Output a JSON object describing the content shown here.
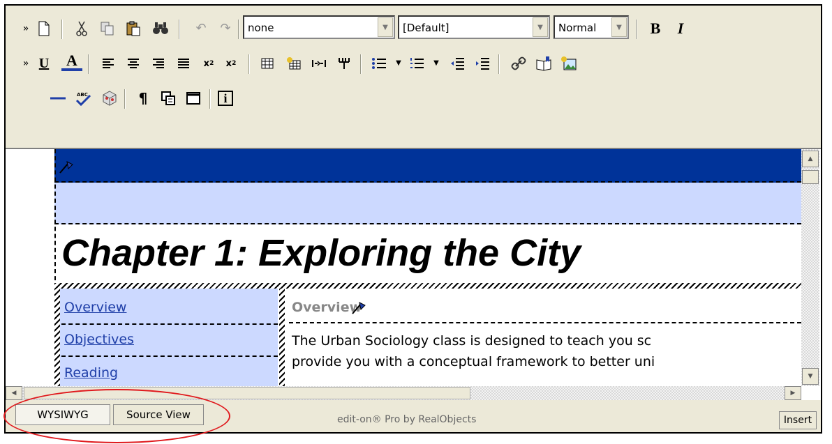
{
  "toolbar": {
    "style_combo": "none",
    "font_combo": "[Default]",
    "size_combo": "Normal",
    "bold_label": "B",
    "italic_label": "I",
    "underline_label": "U",
    "font_color_label": "A",
    "info_label": "i",
    "icons": [
      "new-document-icon",
      "cut-icon",
      "copy-icon",
      "paste-icon",
      "find-icon",
      "undo-icon",
      "redo-icon",
      "bold-icon",
      "italic-icon",
      "underline-icon",
      "font-color-icon",
      "align-left-icon",
      "align-center-icon",
      "align-right-icon",
      "justify-icon",
      "subscript-icon",
      "superscript-icon",
      "table-icon",
      "insert-cell-icon",
      "split-cell-icon",
      "merge-cell-icon",
      "bullet-list-icon",
      "numbered-list-icon",
      "outdent-icon",
      "indent-icon",
      "hyperlink-icon",
      "bookmark-icon",
      "insert-image-icon",
      "horizontal-rule-icon",
      "spell-check-icon",
      "object-icon",
      "paragraph-marks-icon",
      "special-char-icon",
      "fullscreen-icon",
      "about-icon"
    ]
  },
  "document": {
    "title": "Chapter 1: Exploring the City",
    "nav": [
      "Overview",
      "Objectives",
      "Reading"
    ],
    "overview_heading": "Overview",
    "body_lines": [
      "The Urban Sociology class is designed to teach you sc",
      "provide you with a conceptual framework to better uni"
    ]
  },
  "status": {
    "tab_wysiwyg": "WYSIWYG",
    "tab_source": "Source View",
    "credit": "edit-on® Pro by RealObjects",
    "mode": "Insert"
  },
  "colors": {
    "dark_band": "#003399",
    "light_band": "#ccd9ff",
    "highlight": "#e0191d"
  }
}
